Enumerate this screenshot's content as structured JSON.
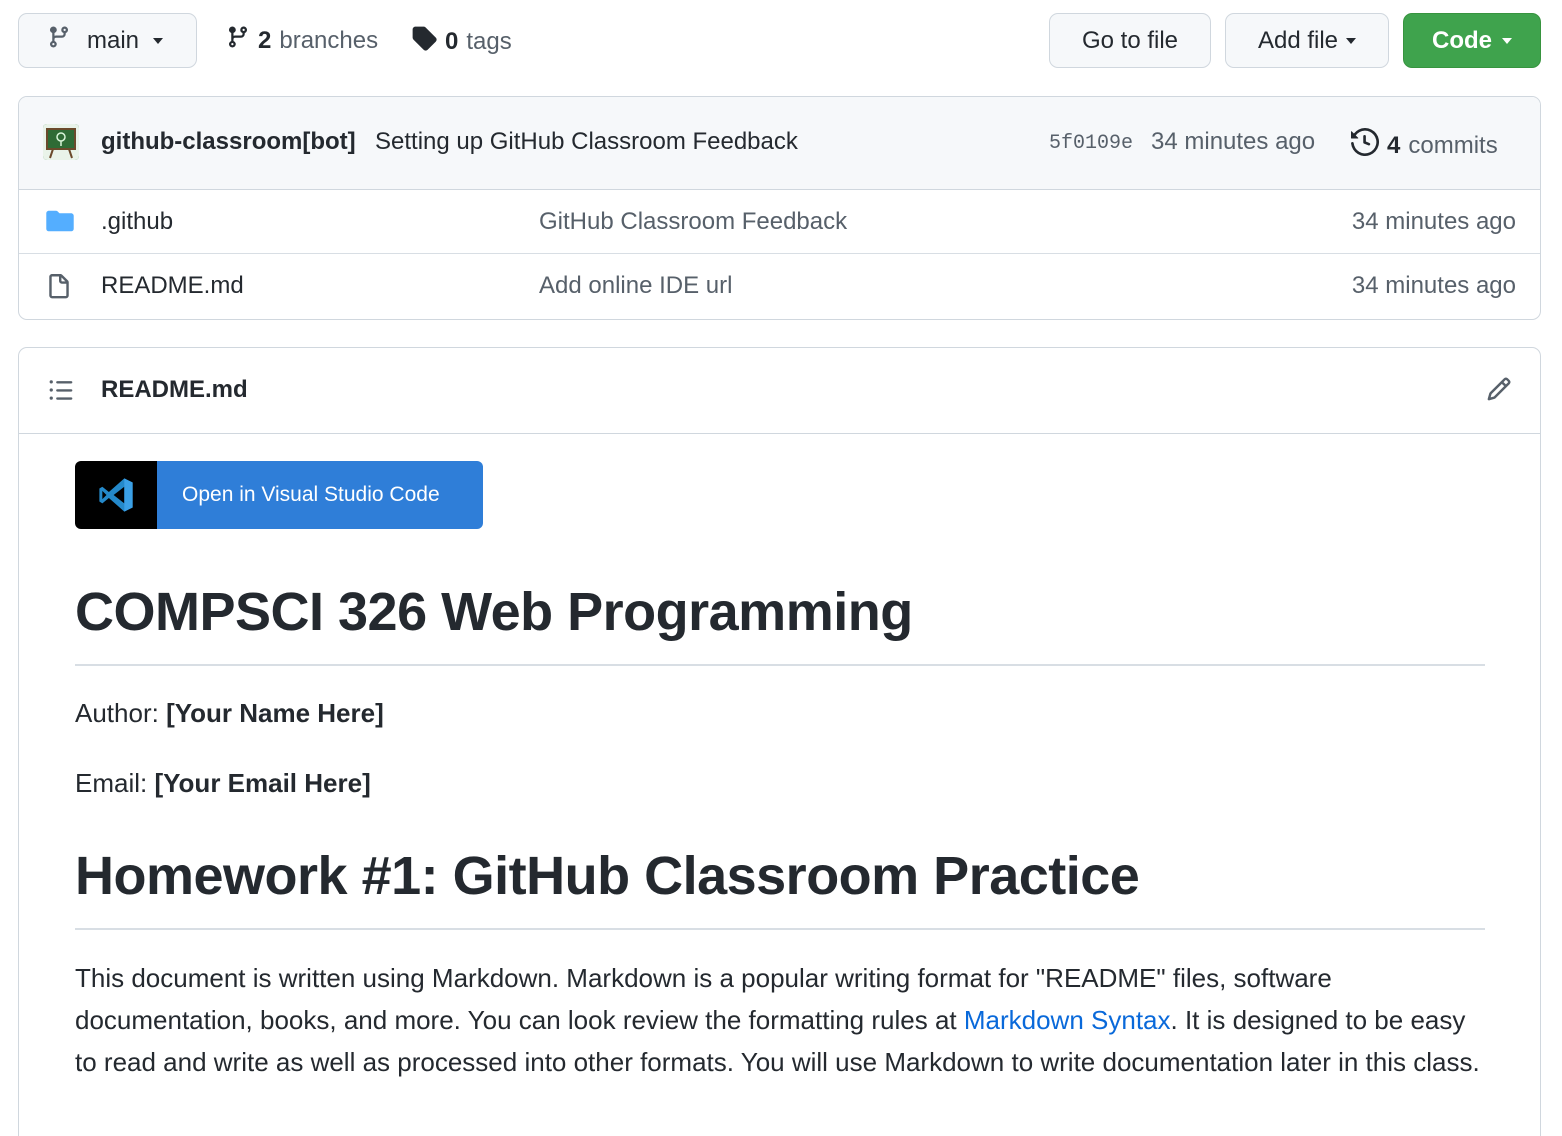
{
  "toolbar": {
    "branch": "main",
    "branches_count": "2",
    "branches_label": "branches",
    "tags_count": "0",
    "tags_label": "tags",
    "go_to_file": "Go to file",
    "add_file": "Add file",
    "code": "Code"
  },
  "commit": {
    "author": "github-classroom[bot]",
    "message": "Setting up GitHub Classroom Feedback",
    "sha": "5f0109e",
    "time": "34 minutes ago",
    "commits_count": "4",
    "commits_label": "commits"
  },
  "files": [
    {
      "name": ".github",
      "type": "folder",
      "message": "GitHub Classroom Feedback",
      "time": "34 minutes ago"
    },
    {
      "name": "README.md",
      "type": "file",
      "message": "Add online IDE url",
      "time": "34 minutes ago"
    }
  ],
  "readme": {
    "title": "README.md",
    "badge_label": "Open in Visual Studio Code",
    "h1": "COMPSCI 326 Web Programming",
    "author_label": "Author:",
    "author_value": "[Your Name Here]",
    "email_label": "Email:",
    "email_value": "[Your Email Here]",
    "h2": "Homework #1: GitHub Classroom Practice",
    "para_part1": "This document is written using Markdown. Markdown is a popular writing format for \"README\" files, software documentation, books, and more. You can look review the formatting rules at ",
    "para_link": "Markdown Syntax",
    "para_part2": ". It is designed to be easy to read and write as well as processed into other formats. You will use Markdown to write documentation later in this class."
  },
  "colors": {
    "accent_green": "#3fa34d",
    "link_blue": "#0969da",
    "badge_blue": "#2f7ed8",
    "folder_blue": "#54aeff"
  },
  "icons": [
    "git-branch-icon",
    "tag-icon",
    "history-icon",
    "folder-icon",
    "file-icon",
    "list-icon",
    "pencil-icon",
    "vscode-icon"
  ]
}
